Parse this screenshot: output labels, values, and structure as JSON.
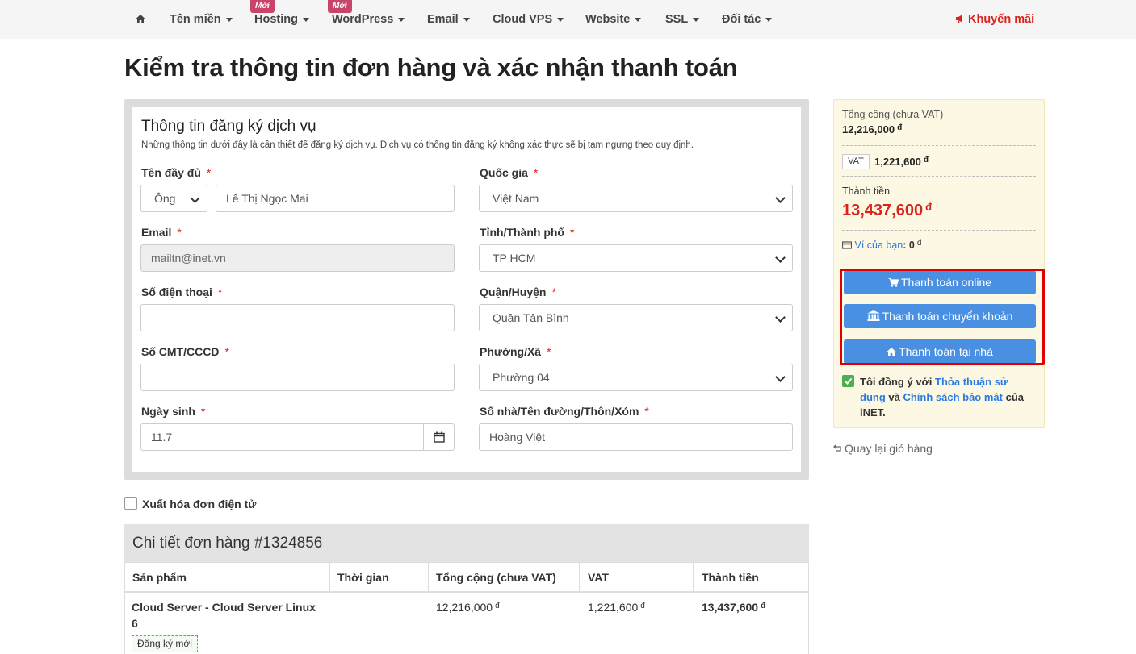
{
  "nav": {
    "items": [
      {
        "label": "Tên miền",
        "badge": ""
      },
      {
        "label": "Hosting",
        "badge": "Mới"
      },
      {
        "label": "WordPress",
        "badge": "Mới"
      },
      {
        "label": "Email",
        "badge": ""
      },
      {
        "label": "Cloud VPS",
        "badge": ""
      },
      {
        "label": "Website",
        "badge": ""
      },
      {
        "label": "SSL",
        "badge": ""
      },
      {
        "label": "Đối tác",
        "badge": ""
      }
    ],
    "promo": "Khuyến mãi"
  },
  "page": {
    "title": "Kiểm tra thông tin đơn hàng và xác nhận thanh toán"
  },
  "form": {
    "title": "Thông tin đăng ký dịch vụ",
    "description": "Những thông tin dưới đây là cần thiết để đăng ký dịch vụ. Dịch vụ có thông tin đăng ký không xác thực sẽ bị tạm ngưng theo quy định.",
    "required_mark": "*",
    "fullname": {
      "label": "Tên đầy đủ",
      "salutation": "Ông",
      "value": "Lê Thị Ngọc Mai"
    },
    "country": {
      "label": "Quốc gia",
      "value": "Việt Nam"
    },
    "email": {
      "label": "Email",
      "value": "mailtn@inet.vn"
    },
    "city": {
      "label": "Tỉnh/Thành phố",
      "value": "TP HCM"
    },
    "phone": {
      "label": "Số điện thoại",
      "value": ""
    },
    "district": {
      "label": "Quận/Huyện",
      "value": "Quận Tân Bình"
    },
    "id_number": {
      "label": "Số CMT/CCCD",
      "value": ""
    },
    "ward": {
      "label": "Phường/Xã",
      "value": "Phường 04"
    },
    "birthday": {
      "label": "Ngày sinh",
      "value": "11.7"
    },
    "address": {
      "label": "Số nhà/Tên đường/Thôn/Xóm",
      "value": "Hoàng Việt"
    }
  },
  "invoice_checkbox": {
    "label": "Xuất hóa đơn điện tử",
    "checked": false
  },
  "order": {
    "title": "Chi tiết đơn hàng #1324856",
    "columns": [
      "Sản phẩm",
      "Thời gian",
      "Tổng cộng (chưa VAT)",
      "VAT",
      "Thành tiền"
    ],
    "rows": [
      {
        "product_line1": "Cloud Server - Cloud Server Linux",
        "product_line2": "6",
        "tag": "Đăng ký mới",
        "time": "",
        "subtotal": "12,216,000",
        "vat": "1,221,600",
        "total": "13,437,600"
      }
    ]
  },
  "currency": "đ",
  "summary": {
    "subtotal_label": "Tổng cộng (chưa VAT)",
    "subtotal": "12,216,000",
    "vat_label": "VAT",
    "vat": "1,221,600",
    "total_label": "Thành tiền",
    "total": "13,437,600",
    "wallet_label": "Ví của bạn",
    "wallet_value": "0",
    "buttons": {
      "online": "Thanh toán online",
      "transfer": "Thanh toán chuyển khoản",
      "home": "Thanh toán tại nhà"
    },
    "agree_prefix": "Tôi đồng ý với ",
    "agree_terms": "Thỏa thuận sử dụng",
    "agree_and": " và ",
    "agree_privacy": "Chính sách bảo mật",
    "agree_suffix": " của iNET."
  },
  "back_link": "Quay lại giỏ hàng",
  "colors": {
    "accent": "#4a90e2",
    "danger": "#d9231d",
    "highlight_box": "#e00000",
    "summary_bg": "#fcf8e3"
  }
}
